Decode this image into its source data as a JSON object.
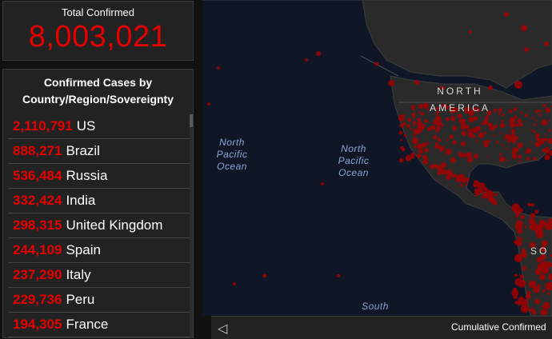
{
  "total": {
    "label": "Total Confirmed",
    "value": "8,003,021"
  },
  "cases": {
    "title": "Confirmed Cases by Country/Region/Sovereignty",
    "rows": [
      {
        "count": "2,110,791",
        "country": "US"
      },
      {
        "count": "888,271",
        "country": "Brazil"
      },
      {
        "count": "536,484",
        "country": "Russia"
      },
      {
        "count": "332,424",
        "country": "India"
      },
      {
        "count": "298,315",
        "country": "United Kingdom"
      },
      {
        "count": "244,109",
        "country": "Spain"
      },
      {
        "count": "237,290",
        "country": "Italy"
      },
      {
        "count": "229,736",
        "country": "Peru"
      },
      {
        "count": "194,305",
        "country": "France"
      }
    ]
  },
  "map": {
    "labels": {
      "north_pacific_1": "North Pacific Ocean",
      "north_pacific_2": "North Pacific Ocean",
      "south_pacific": "South",
      "north_america": "NORTH AMERICA",
      "south_america": "SO"
    },
    "colors": {
      "ocean": "#0f1626",
      "land": "#2a2a2a",
      "marker": "#a30000"
    }
  },
  "bottom_bar": {
    "back_icon": "chevron-left-icon",
    "tab_label": "Cumulative Confirmed"
  }
}
